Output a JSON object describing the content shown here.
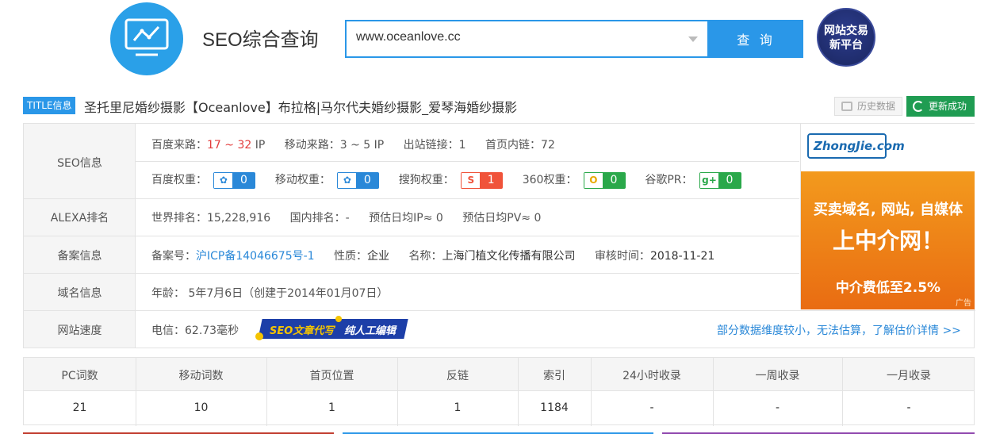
{
  "header": {
    "app_title": "SEO综合查询",
    "search_value": "www.oceanlove.cc",
    "search_button": "查 询",
    "trade_badge_line1": "网站交易",
    "trade_badge_line2": "新平台"
  },
  "title_row": {
    "tag": "TITLE信息",
    "site_title": "圣托里尼婚纱摄影【Oceanlove】布拉格|马尔代夫婚纱摄影_爱琴海婚纱摄影",
    "history_button": "历史数据",
    "refresh_button": "更新成功"
  },
  "seo": {
    "label": "SEO信息",
    "baidu_traffic_label": "百度来路：",
    "baidu_traffic_value": "17 ~ 32",
    "baidu_traffic_unit": "IP",
    "mobile_traffic_label": "移动来路：",
    "mobile_traffic_value": "3 ~ 5 IP",
    "outlinks_label": "出站链接：",
    "outlinks_value": "1",
    "homepage_links_label": "首页内链：",
    "homepage_links_value": "72",
    "baidu_weight_label": "百度权重：",
    "baidu_weight_value": "0",
    "mobile_weight_label": "移动权重：",
    "mobile_weight_value": "0",
    "sogou_weight_label": "搜狗权重：",
    "sogou_weight_value": "1",
    "weight360_label": "360权重：",
    "weight360_value": "0",
    "google_pr_label": "谷歌PR：",
    "google_pr_value": "0"
  },
  "alexa": {
    "label": "ALEXA排名",
    "world_rank": "世界排名：15,228,916",
    "domestic_rank": "国内排名：-",
    "est_ip": "预估日均IP≈ 0",
    "est_pv": "预估日均PV≈ 0"
  },
  "icp": {
    "label": "备案信息",
    "number_label": "备案号：",
    "number_value": "沪ICP备14046675号-1",
    "nature_label": "性质：",
    "nature_value": "企业",
    "name_label": "名称：",
    "name_value": "上海门植文化传播有限公司",
    "review_label": "审核时间：",
    "review_value": "2018-11-21"
  },
  "domain": {
    "label": "域名信息",
    "age": "年龄： 5年7月6日（创建于2014年01月07日）"
  },
  "speed": {
    "label": "网站速度",
    "telecom": "电信：62.73毫秒",
    "banner_text1": "SEO文章代写",
    "banner_text2": "纯人工编辑",
    "estimate_link": "部分数据维度较小，无法估算，了解估价详情 >>"
  },
  "ad": {
    "logo_text": "ZhongJie.com",
    "line1": "买卖域名, 网站, 自媒体",
    "line2": "上中介网！",
    "line3": "中介费低至2.5%",
    "tag": "广告"
  },
  "stats": {
    "headers": [
      "PC词数",
      "移动词数",
      "首页位置",
      "反链",
      "索引",
      "24小时收录",
      "一周收录",
      "一月收录"
    ],
    "values": [
      "21",
      "10",
      "1",
      "1",
      "1184",
      "-",
      "-",
      "-"
    ]
  },
  "colors": {
    "accent": "#2a97e8",
    "success": "#1f9c52",
    "traffic_red": "#e23c3c",
    "link_blue": "#2a88d8"
  }
}
